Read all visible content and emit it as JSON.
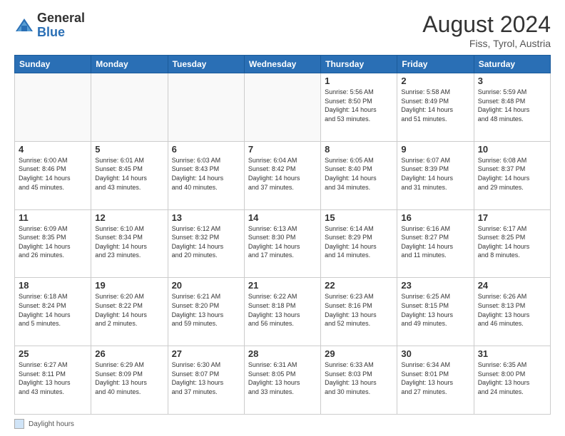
{
  "header": {
    "logo_general": "General",
    "logo_blue": "Blue",
    "month_year": "August 2024",
    "location": "Fiss, Tyrol, Austria"
  },
  "footer": {
    "legend_label": "Daylight hours"
  },
  "days_of_week": [
    "Sunday",
    "Monday",
    "Tuesday",
    "Wednesday",
    "Thursday",
    "Friday",
    "Saturday"
  ],
  "weeks": [
    [
      {
        "day": "",
        "info": ""
      },
      {
        "day": "",
        "info": ""
      },
      {
        "day": "",
        "info": ""
      },
      {
        "day": "",
        "info": ""
      },
      {
        "day": "1",
        "info": "Sunrise: 5:56 AM\nSunset: 8:50 PM\nDaylight: 14 hours\nand 53 minutes."
      },
      {
        "day": "2",
        "info": "Sunrise: 5:58 AM\nSunset: 8:49 PM\nDaylight: 14 hours\nand 51 minutes."
      },
      {
        "day": "3",
        "info": "Sunrise: 5:59 AM\nSunset: 8:48 PM\nDaylight: 14 hours\nand 48 minutes."
      }
    ],
    [
      {
        "day": "4",
        "info": "Sunrise: 6:00 AM\nSunset: 8:46 PM\nDaylight: 14 hours\nand 45 minutes."
      },
      {
        "day": "5",
        "info": "Sunrise: 6:01 AM\nSunset: 8:45 PM\nDaylight: 14 hours\nand 43 minutes."
      },
      {
        "day": "6",
        "info": "Sunrise: 6:03 AM\nSunset: 8:43 PM\nDaylight: 14 hours\nand 40 minutes."
      },
      {
        "day": "7",
        "info": "Sunrise: 6:04 AM\nSunset: 8:42 PM\nDaylight: 14 hours\nand 37 minutes."
      },
      {
        "day": "8",
        "info": "Sunrise: 6:05 AM\nSunset: 8:40 PM\nDaylight: 14 hours\nand 34 minutes."
      },
      {
        "day": "9",
        "info": "Sunrise: 6:07 AM\nSunset: 8:39 PM\nDaylight: 14 hours\nand 31 minutes."
      },
      {
        "day": "10",
        "info": "Sunrise: 6:08 AM\nSunset: 8:37 PM\nDaylight: 14 hours\nand 29 minutes."
      }
    ],
    [
      {
        "day": "11",
        "info": "Sunrise: 6:09 AM\nSunset: 8:35 PM\nDaylight: 14 hours\nand 26 minutes."
      },
      {
        "day": "12",
        "info": "Sunrise: 6:10 AM\nSunset: 8:34 PM\nDaylight: 14 hours\nand 23 minutes."
      },
      {
        "day": "13",
        "info": "Sunrise: 6:12 AM\nSunset: 8:32 PM\nDaylight: 14 hours\nand 20 minutes."
      },
      {
        "day": "14",
        "info": "Sunrise: 6:13 AM\nSunset: 8:30 PM\nDaylight: 14 hours\nand 17 minutes."
      },
      {
        "day": "15",
        "info": "Sunrise: 6:14 AM\nSunset: 8:29 PM\nDaylight: 14 hours\nand 14 minutes."
      },
      {
        "day": "16",
        "info": "Sunrise: 6:16 AM\nSunset: 8:27 PM\nDaylight: 14 hours\nand 11 minutes."
      },
      {
        "day": "17",
        "info": "Sunrise: 6:17 AM\nSunset: 8:25 PM\nDaylight: 14 hours\nand 8 minutes."
      }
    ],
    [
      {
        "day": "18",
        "info": "Sunrise: 6:18 AM\nSunset: 8:24 PM\nDaylight: 14 hours\nand 5 minutes."
      },
      {
        "day": "19",
        "info": "Sunrise: 6:20 AM\nSunset: 8:22 PM\nDaylight: 14 hours\nand 2 minutes."
      },
      {
        "day": "20",
        "info": "Sunrise: 6:21 AM\nSunset: 8:20 PM\nDaylight: 13 hours\nand 59 minutes."
      },
      {
        "day": "21",
        "info": "Sunrise: 6:22 AM\nSunset: 8:18 PM\nDaylight: 13 hours\nand 56 minutes."
      },
      {
        "day": "22",
        "info": "Sunrise: 6:23 AM\nSunset: 8:16 PM\nDaylight: 13 hours\nand 52 minutes."
      },
      {
        "day": "23",
        "info": "Sunrise: 6:25 AM\nSunset: 8:15 PM\nDaylight: 13 hours\nand 49 minutes."
      },
      {
        "day": "24",
        "info": "Sunrise: 6:26 AM\nSunset: 8:13 PM\nDaylight: 13 hours\nand 46 minutes."
      }
    ],
    [
      {
        "day": "25",
        "info": "Sunrise: 6:27 AM\nSunset: 8:11 PM\nDaylight: 13 hours\nand 43 minutes."
      },
      {
        "day": "26",
        "info": "Sunrise: 6:29 AM\nSunset: 8:09 PM\nDaylight: 13 hours\nand 40 minutes."
      },
      {
        "day": "27",
        "info": "Sunrise: 6:30 AM\nSunset: 8:07 PM\nDaylight: 13 hours\nand 37 minutes."
      },
      {
        "day": "28",
        "info": "Sunrise: 6:31 AM\nSunset: 8:05 PM\nDaylight: 13 hours\nand 33 minutes."
      },
      {
        "day": "29",
        "info": "Sunrise: 6:33 AM\nSunset: 8:03 PM\nDaylight: 13 hours\nand 30 minutes."
      },
      {
        "day": "30",
        "info": "Sunrise: 6:34 AM\nSunset: 8:01 PM\nDaylight: 13 hours\nand 27 minutes."
      },
      {
        "day": "31",
        "info": "Sunrise: 6:35 AM\nSunset: 8:00 PM\nDaylight: 13 hours\nand 24 minutes."
      }
    ]
  ]
}
